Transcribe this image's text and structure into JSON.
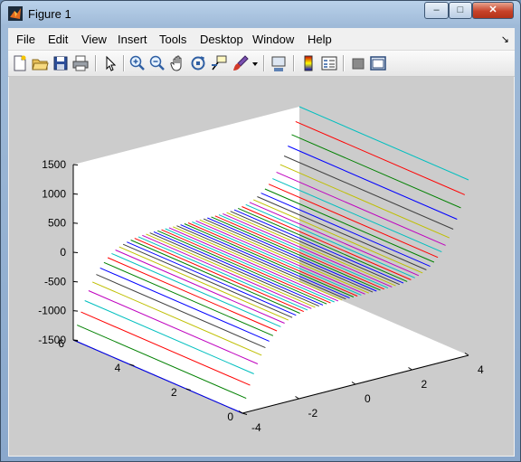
{
  "window": {
    "title": "Figure 1",
    "minimize": "–",
    "maximize": "□",
    "close": "✕"
  },
  "menu": [
    "File",
    "Edit",
    "View",
    "Insert",
    "Tools",
    "Desktop",
    "Window",
    "Help"
  ],
  "menu_overflow": "↘",
  "toolbar": [
    "new-figure-icon",
    "open-file-icon",
    "save-icon",
    "print-icon",
    "edit-plot-arrow-icon",
    "zoom-in-icon",
    "zoom-out-icon",
    "pan-hand-icon",
    "rotate-3d-icon",
    "data-cursor-icon",
    "brush-icon",
    "brush-dropdown-icon",
    "link-plot-icon",
    "colorbar-icon",
    "legend-icon",
    "hide-plot-tools-icon",
    "show-plot-tools-icon"
  ],
  "chart_data": {
    "type": "3d-line",
    "z_ticks": [
      "1500",
      "1000",
      "500",
      "0",
      "-500",
      "-1000",
      "-1500"
    ],
    "y_ticks": [
      "6",
      "4",
      "2",
      "0"
    ],
    "x_ticks": [
      "-4",
      "-2",
      "0",
      "2",
      "4"
    ],
    "zlim": [
      -1500,
      1500
    ],
    "xlim": [
      -4,
      4
    ],
    "ylim": [
      0,
      6
    ],
    "curve": "z = x^5",
    "line_count": 60,
    "colors": [
      "#0000ff",
      "#008000",
      "#ff0000",
      "#00bfbf",
      "#bf00bf",
      "#bfbf00",
      "#404040"
    ]
  }
}
